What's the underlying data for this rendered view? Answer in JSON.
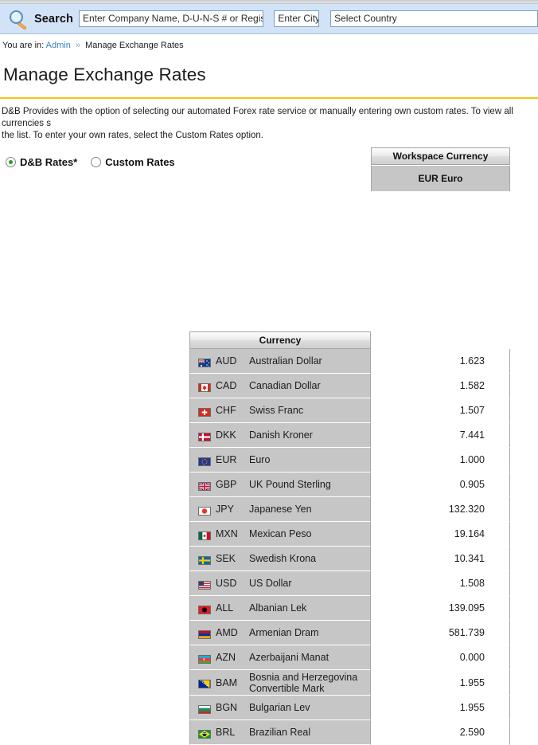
{
  "search": {
    "icon": "magnifier-icon",
    "label": "Search",
    "company_placeholder": "Enter Company Name, D-U-N-S # or Registration #",
    "city_placeholder": "Enter City",
    "country_placeholder": "Select Country"
  },
  "breadcrumb": {
    "prefix": "You are in:",
    "link": "Admin",
    "separator": "»",
    "current": "Manage Exchange Rates"
  },
  "page": {
    "title": "Manage Exchange Rates",
    "intro": "D&B Provides with the option of selecting our automated Forex rate service or manually entering own custom rates. To view all currencies s\nthe list. To enter your own rates, select the Custom Rates option."
  },
  "rate_mode": {
    "options": [
      {
        "label": "D&B Rates*",
        "checked": true
      },
      {
        "label": "Custom Rates",
        "checked": false
      }
    ]
  },
  "table": {
    "currency_header": "Currency",
    "workspace_header": "Workspace Currency",
    "workspace_currency": "EUR Euro",
    "rows": [
      {
        "flag": "flag-au",
        "code": "AUD",
        "name": "Australian Dollar",
        "rate": "1.623"
      },
      {
        "flag": "flag-ca",
        "code": "CAD",
        "name": "Canadian Dollar",
        "rate": "1.582"
      },
      {
        "flag": "flag-ch",
        "code": "CHF",
        "name": "Swiss Franc",
        "rate": "1.507"
      },
      {
        "flag": "flag-dk",
        "code": "DKK",
        "name": "Danish Kroner",
        "rate": "7.441"
      },
      {
        "flag": "flag-eu",
        "code": "EUR",
        "name": "Euro",
        "rate": "1.000"
      },
      {
        "flag": "flag-gb",
        "code": "GBP",
        "name": "UK Pound Sterling",
        "rate": "0.905"
      },
      {
        "flag": "flag-jp",
        "code": "JPY",
        "name": "Japanese Yen",
        "rate": "132.320"
      },
      {
        "flag": "flag-mx",
        "code": "MXN",
        "name": "Mexican Peso",
        "rate": "19.164"
      },
      {
        "flag": "flag-se",
        "code": "SEK",
        "name": "Swedish Krona",
        "rate": "10.341"
      },
      {
        "flag": "flag-us",
        "code": "USD",
        "name": "US Dollar",
        "rate": "1.508"
      },
      {
        "flag": "flag-al",
        "code": "ALL",
        "name": "Albanian Lek",
        "rate": "139.095"
      },
      {
        "flag": "flag-am",
        "code": "AMD",
        "name": "Armenian Dram",
        "rate": "581.739"
      },
      {
        "flag": "flag-az",
        "code": "AZN",
        "name": "Azerbaijani Manat",
        "rate": "0.000"
      },
      {
        "flag": "flag-ba",
        "code": "BAM",
        "name": "Bosnia and Herzegovina Convertible Mark",
        "rate": "1.955"
      },
      {
        "flag": "flag-bg",
        "code": "BGN",
        "name": "Bulgarian Lev",
        "rate": "1.955"
      },
      {
        "flag": "flag-br",
        "code": "BRL",
        "name": "Brazilian Real",
        "rate": "2.590"
      }
    ]
  },
  "colors": {
    "search_bar": "#d3e3f7",
    "title_rule": "#f5c518",
    "row_grey": "#c6c6c6",
    "link": "#3f7fbf",
    "radio_dot": "#2c9c2c"
  }
}
